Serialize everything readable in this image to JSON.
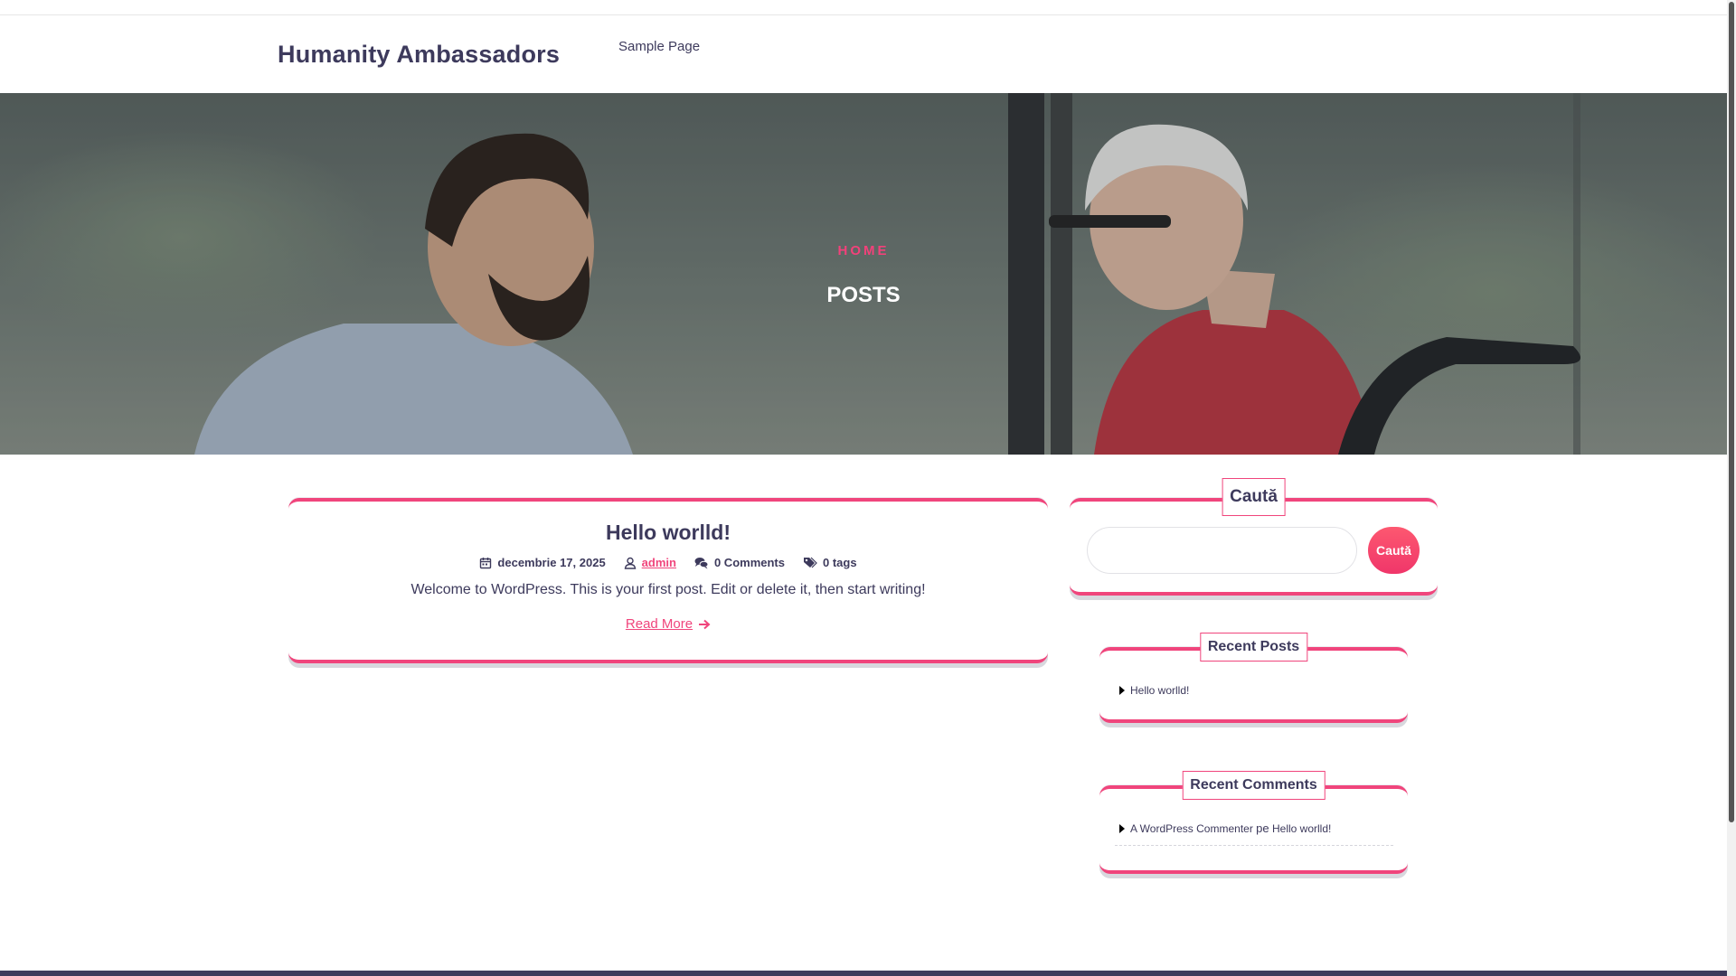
{
  "site": {
    "title": "Humanity Ambassadors"
  },
  "nav": {
    "items": [
      {
        "label": "Sample Page"
      }
    ]
  },
  "hero": {
    "breadcrumb": "HOME",
    "title": "POSTS"
  },
  "post": {
    "title": "Hello worlld!",
    "date": "decembrie 17, 2025",
    "author": "admin",
    "comments": "0 Comments",
    "tags": "0 tags",
    "excerpt": "Welcome to WordPress. This is your first post. Edit or delete it, then start writing!",
    "read_more": "Read More"
  },
  "sidebar": {
    "search": {
      "title": "Caută",
      "placeholder": "",
      "button": "Caută"
    },
    "recent_posts": {
      "title": "Recent Posts",
      "items": [
        "Hello worlld!"
      ]
    },
    "recent_comments": {
      "title": "Recent Comments",
      "items": [
        {
          "author": "A WordPress Commenter",
          "connector": "pe",
          "post": "Hello worlld!"
        }
      ]
    }
  },
  "colors": {
    "accent": "#f0457c",
    "text": "#3d3a5c",
    "footer": "#3d3a5c"
  },
  "icons": [
    "calendar-icon",
    "user-icon",
    "comments-icon",
    "tags-icon",
    "arrow-right-icon",
    "caret-right-icon"
  ]
}
